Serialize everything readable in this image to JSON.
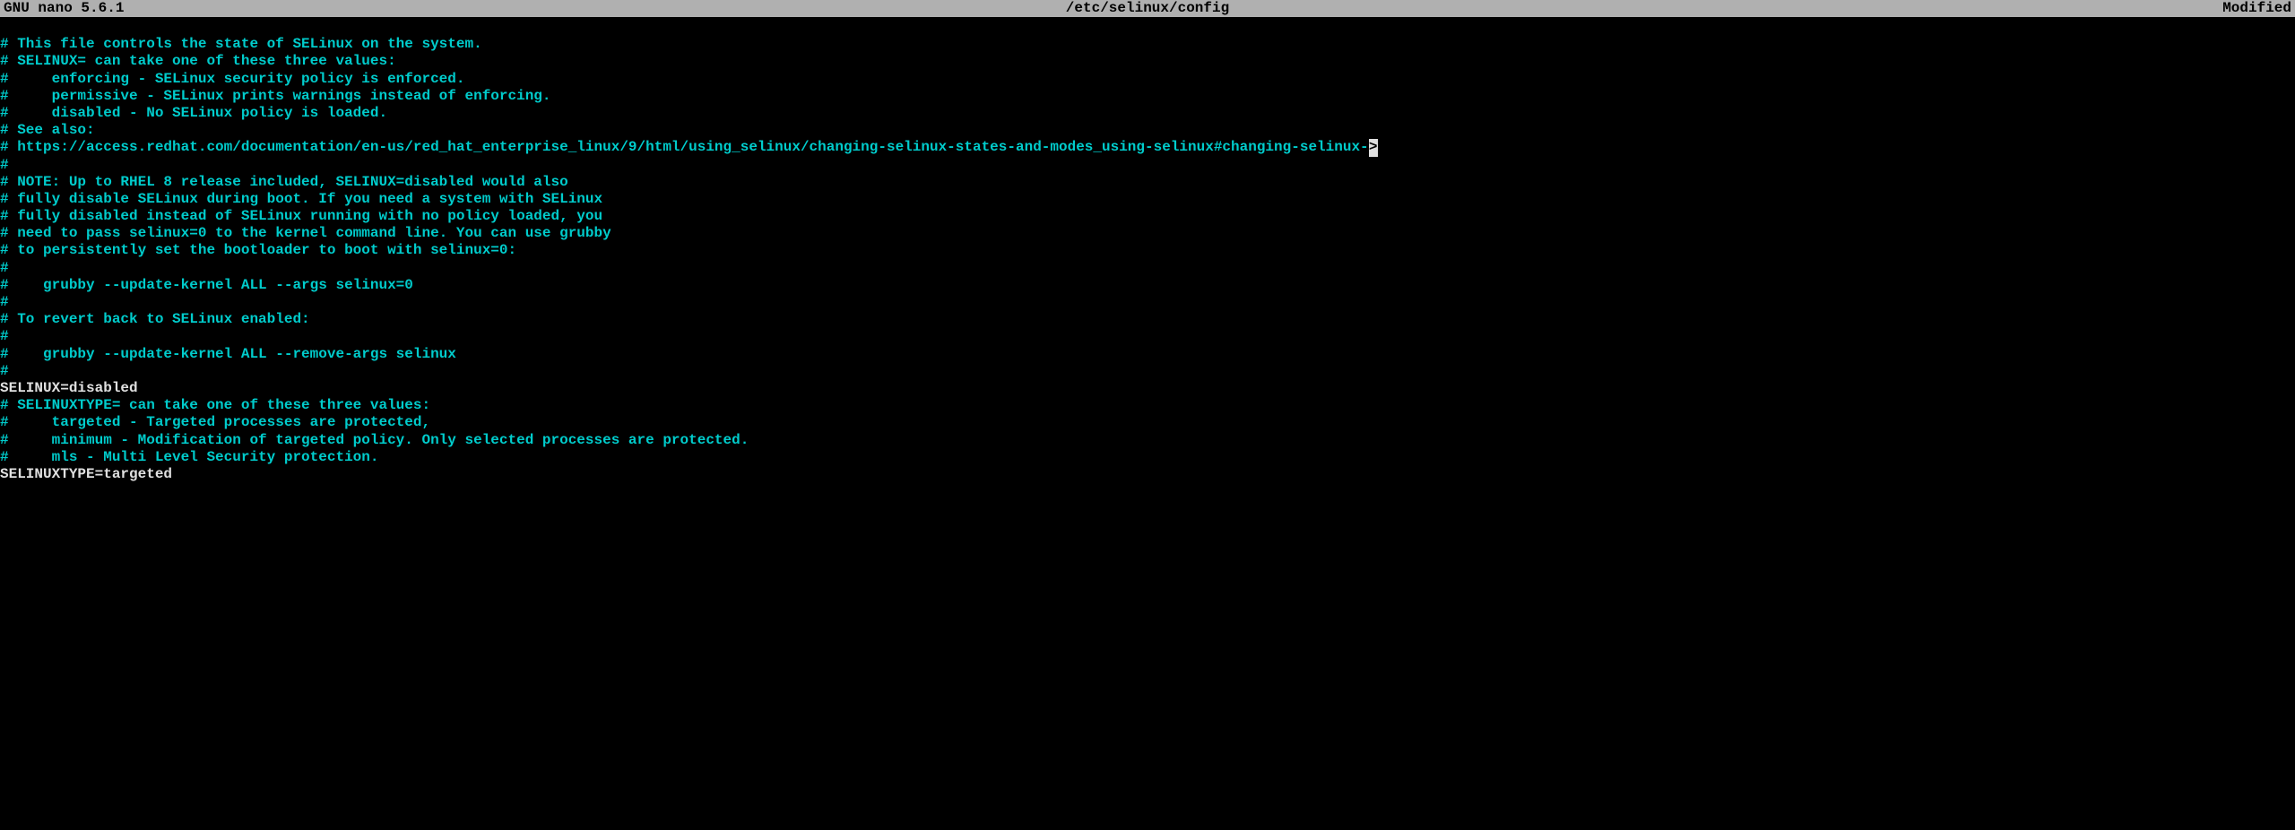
{
  "titlebar": {
    "left": "  GNU nano 5.6.1",
    "center": "/etc/selinux/config",
    "right": "Modified  "
  },
  "lines": [
    {
      "type": "blank",
      "text": ""
    },
    {
      "type": "comment",
      "text": "# This file controls the state of SELinux on the system."
    },
    {
      "type": "comment",
      "text": "# SELINUX= can take one of these three values:"
    },
    {
      "type": "comment",
      "text": "#     enforcing - SELinux security policy is enforced."
    },
    {
      "type": "comment",
      "text": "#     permissive - SELinux prints warnings instead of enforcing."
    },
    {
      "type": "comment",
      "text": "#     disabled - No SELinux policy is loaded."
    },
    {
      "type": "comment",
      "text": "# See also:"
    },
    {
      "type": "comment-overflow",
      "text": "# https://access.redhat.com/documentation/en-us/red_hat_enterprise_linux/9/html/using_selinux/changing-selinux-states-and-modes_using-selinux#changing-selinux-",
      "overflow": ">"
    },
    {
      "type": "comment",
      "text": "#"
    },
    {
      "type": "comment",
      "text": "# NOTE: Up to RHEL 8 release included, SELINUX=disabled would also"
    },
    {
      "type": "comment",
      "text": "# fully disable SELinux during boot. If you need a system with SELinux"
    },
    {
      "type": "comment",
      "text": "# fully disabled instead of SELinux running with no policy loaded, you"
    },
    {
      "type": "comment",
      "text": "# need to pass selinux=0 to the kernel command line. You can use grubby"
    },
    {
      "type": "comment",
      "text": "# to persistently set the bootloader to boot with selinux=0:"
    },
    {
      "type": "comment",
      "text": "#"
    },
    {
      "type": "comment",
      "text": "#    grubby --update-kernel ALL --args selinux=0"
    },
    {
      "type": "comment",
      "text": "#"
    },
    {
      "type": "comment",
      "text": "# To revert back to SELinux enabled:"
    },
    {
      "type": "comment",
      "text": "#"
    },
    {
      "type": "comment",
      "text": "#    grubby --update-kernel ALL --remove-args selinux"
    },
    {
      "type": "comment",
      "text": "#"
    },
    {
      "type": "setting",
      "text": "SELINUX=disabled"
    },
    {
      "type": "comment",
      "text": "# SELINUXTYPE= can take one of these three values:"
    },
    {
      "type": "comment",
      "text": "#     targeted - Targeted processes are protected,"
    },
    {
      "type": "comment",
      "text": "#     minimum - Modification of targeted policy. Only selected processes are protected."
    },
    {
      "type": "comment",
      "text": "#     mls - Multi Level Security protection."
    },
    {
      "type": "setting",
      "text": "SELINUXTYPE=targeted"
    }
  ]
}
